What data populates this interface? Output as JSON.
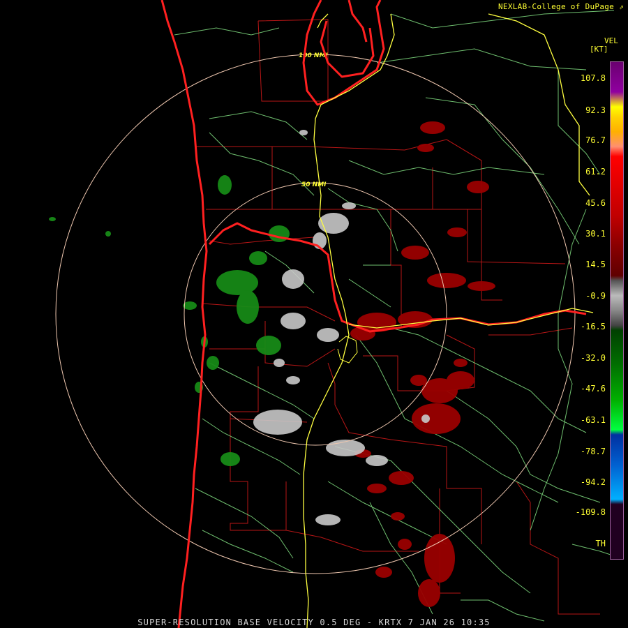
{
  "credit": "NEXLAB-College of DuPage",
  "credit_icon": "external-link-icon",
  "footer": "SUPER-RESOLUTION BASE VELOCITY 0.5 DEG - KRTX 7 JAN 26 10:35",
  "legend": {
    "product": "VEL",
    "unit": "[KT]",
    "ticks": [
      "107.8",
      "92.3",
      "76.7",
      "61.2",
      "45.6",
      "30.1",
      "14.5",
      "-0.9",
      "-16.5",
      "-32.0",
      "-47.6",
      "-63.1",
      "-78.7",
      "-94.2",
      "-109.8",
      "TH"
    ]
  },
  "rings": [
    {
      "label": "100 NMI"
    },
    {
      "label": "50 NMI"
    }
  ],
  "colors": {
    "background": "#000000",
    "range_ring": "#f0c8b0",
    "state_border": "#ff2020",
    "county_border": "#c01818",
    "highway": "#ffff40",
    "road_green": "#70c070",
    "outbound": "#a00000",
    "inbound": "#1a8a1a",
    "neutral": "#c8c8c8",
    "label": "#ffff33"
  }
}
